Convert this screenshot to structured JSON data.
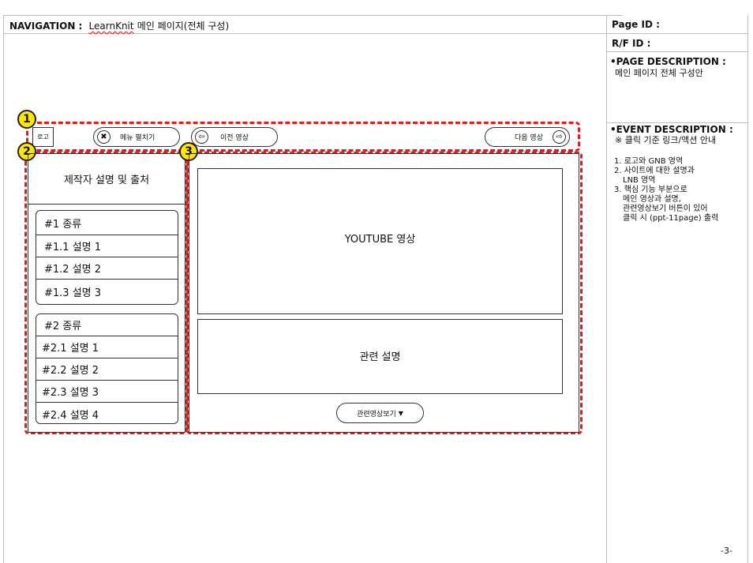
{
  "header": {
    "nav_label": "NAVIGATION :",
    "nav_app": "LearnKnit",
    "nav_page": "메인 페이지(전체 구성)",
    "page_id_label": "Page ID :",
    "rf_id_label": "R/F ID :"
  },
  "side": {
    "page_desc_title": "•PAGE DESCRIPTION :",
    "page_desc_text": "메인 페이지 전체 구성안",
    "event_desc_title": "•EVENT DESCRIPTION :",
    "event_note": "※ 클릭 기준 링크/액션 안내",
    "event_items": [
      "1. 로고와 GNB 영역",
      "2. 사이트에 대한 설명과",
      "LNB 영역",
      "3. 핵심 기능 부분으로",
      "메인 영상과 설명,",
      "관련영상보기 버튼이 있어",
      "클릭 시 (ppt-11page) 출력"
    ]
  },
  "badges": [
    "1",
    "2",
    "3"
  ],
  "topbar": {
    "logo": "로고",
    "menu_toggle": "메뉴 펼치기",
    "prev_video": "이전 영상",
    "next_video": "다음 영상"
  },
  "sidebar": {
    "creator_info": "제작자 설명 및 출처",
    "group1": {
      "title": "#1 종류",
      "items": [
        "#1.1 설명 1",
        "#1.2 설명 2",
        "#1.3 설명 3"
      ]
    },
    "group2": {
      "title": "#2 종류",
      "items": [
        "#2.1 설명 1",
        "#2.2 설명 2",
        "#2.3 설명 3",
        "#2.4 설명 4"
      ]
    }
  },
  "main": {
    "video_label": "YOUTUBE 영상",
    "desc_label": "관련 설명",
    "related_button": "관련영상보기",
    "related_arrow": "▼"
  },
  "footer": {
    "page_number": "-3-"
  }
}
